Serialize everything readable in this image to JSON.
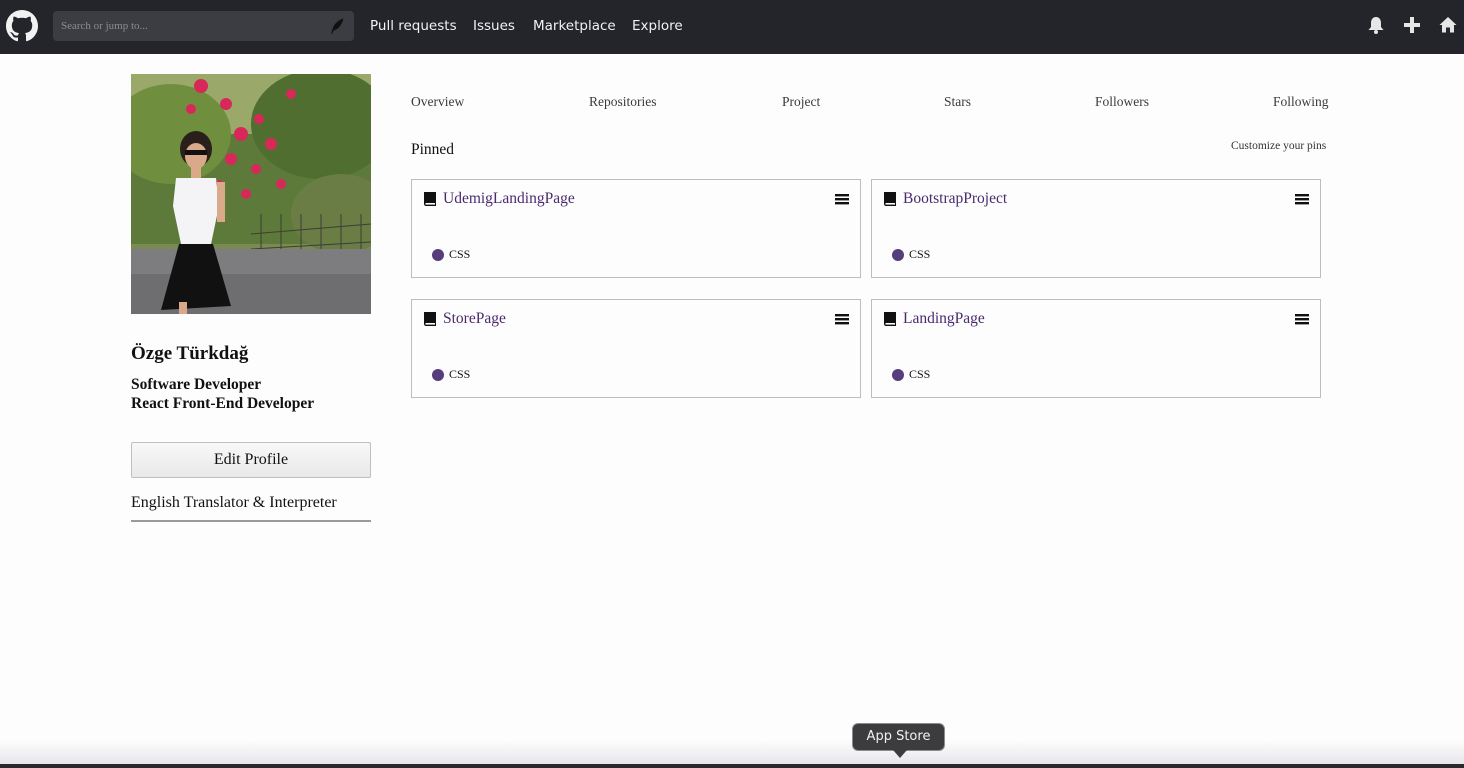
{
  "colors": {
    "topbar": "#23252a",
    "search_bg": "#3b3d42",
    "repo_link": "#4a2a6d",
    "css_language": "#563d7c"
  },
  "topnav": {
    "logo_icon": "github-octocat-icon",
    "search": {
      "placeholder": "Search or jump to...",
      "value": "",
      "icon": "quill-icon"
    },
    "links": [
      "Pull requests",
      "Issues",
      "Marketplace",
      "Explore"
    ],
    "right_icons": [
      "bell-icon",
      "plus-icon",
      "home-icon"
    ]
  },
  "profile": {
    "name": "Özge Türkdağ",
    "bio": [
      "Software Developer",
      "React Front-End Developer"
    ],
    "edit_button": "Edit Profile",
    "extra": "English Translator & Interpreter"
  },
  "tabs": [
    "Overview",
    "Repositories",
    "Project",
    "Stars",
    "Followers",
    "Following"
  ],
  "pinned": {
    "title": "Pinned",
    "customize": "Customize your pins",
    "repos": [
      {
        "name": "UdemigLandingPage",
        "language": "CSS"
      },
      {
        "name": "BootstrapProject",
        "language": "CSS"
      },
      {
        "name": "StorePage",
        "language": "CSS"
      },
      {
        "name": "LandingPage",
        "language": "CSS"
      }
    ]
  },
  "dock": {
    "tooltip": "App Store"
  }
}
